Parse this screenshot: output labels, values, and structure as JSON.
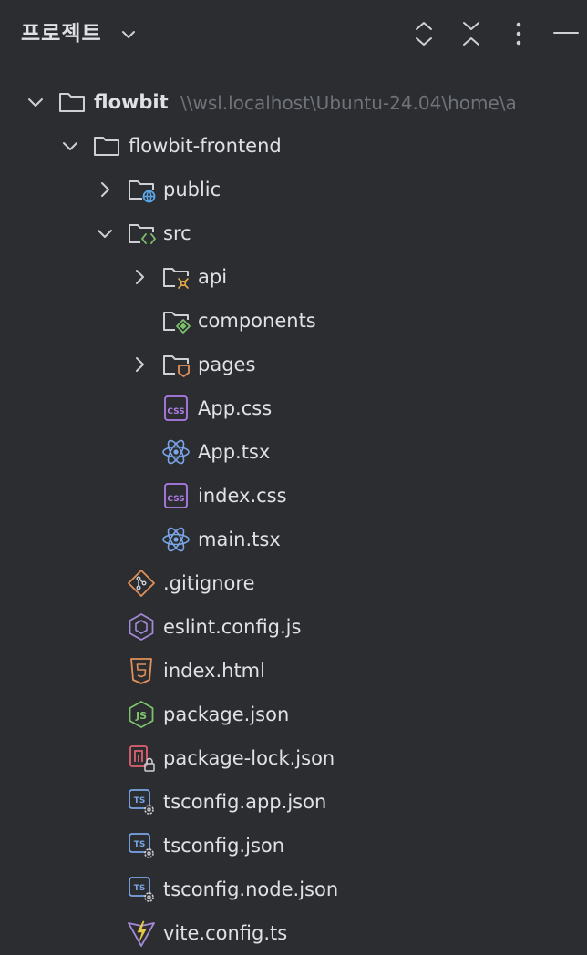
{
  "header": {
    "title": "프로젝트",
    "icons": [
      "chevron-down-icon",
      "expand-all-icon",
      "collapse-all-icon",
      "more-vertical-icon",
      "minimize-icon"
    ]
  },
  "tree": {
    "root": {
      "label": "flowbit",
      "path": "\\\\wsl.localhost\\Ubuntu-24.04\\home\\a"
    },
    "items": [
      {
        "label": "flowbit-frontend",
        "icon": "folder-icon"
      },
      {
        "label": "public",
        "icon": "folder-public-icon"
      },
      {
        "label": "src",
        "icon": "folder-source-icon"
      },
      {
        "label": "api",
        "icon": "folder-api-icon"
      },
      {
        "label": "components",
        "icon": "folder-components-icon"
      },
      {
        "label": "pages",
        "icon": "folder-pages-icon"
      },
      {
        "label": "App.css",
        "icon": "css-file-icon"
      },
      {
        "label": "App.tsx",
        "icon": "react-file-icon"
      },
      {
        "label": "index.css",
        "icon": "css-file-icon"
      },
      {
        "label": "main.tsx",
        "icon": "react-file-icon"
      },
      {
        "label": ".gitignore",
        "icon": "git-file-icon"
      },
      {
        "label": "eslint.config.js",
        "icon": "eslint-file-icon"
      },
      {
        "label": "index.html",
        "icon": "html-file-icon"
      },
      {
        "label": "package.json",
        "icon": "nodejs-file-icon"
      },
      {
        "label": "package-lock.json",
        "icon": "lock-file-icon"
      },
      {
        "label": "tsconfig.app.json",
        "icon": "tsconfig-file-icon"
      },
      {
        "label": "tsconfig.json",
        "icon": "tsconfig-file-icon"
      },
      {
        "label": "tsconfig.node.json",
        "icon": "tsconfig-file-icon"
      },
      {
        "label": "vite.config.ts",
        "icon": "vite-file-icon"
      }
    ]
  },
  "colors": {
    "background": "#2b2d30",
    "text": "#dfe1e5",
    "muted": "#6f737a",
    "icon": "#ced0d6",
    "css": "#b07de8",
    "react": "#7aa6e8",
    "git": "#e0905a",
    "eslint": "#a38ad6",
    "html": "#e0905a",
    "node": "#7ec26e",
    "ts": "#7aa6e8",
    "vite": "#a38ad6"
  }
}
